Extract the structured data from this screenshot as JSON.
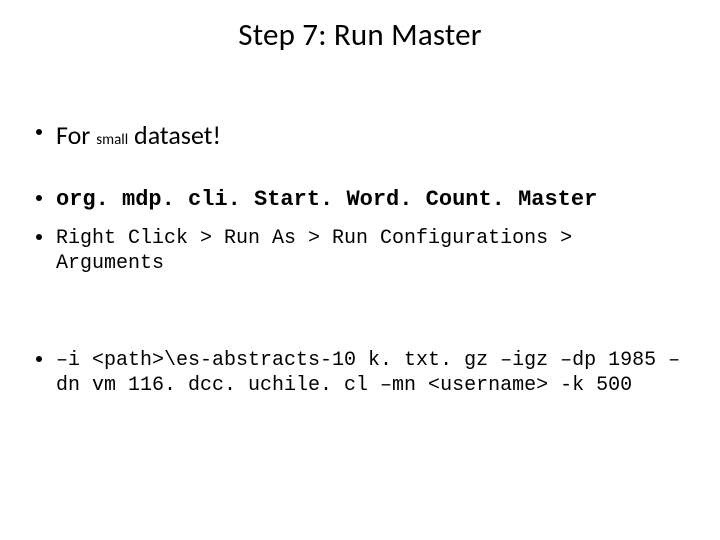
{
  "title": "Step 7: Run Master",
  "bullets": {
    "b1_prefix": "For ",
    "b1_small": "small",
    "b1_suffix": " dataset!",
    "b2": "org. mdp. cli. Start. Word. Count. Master",
    "b3": "Right Click > Run As > Run Configurations > Arguments",
    "b4": "–i <path>\\es-abstracts-10 k. txt. gz –igz –dp 1985 –dn vm 116. dcc. uchile. cl –mn <username> -k 500"
  }
}
